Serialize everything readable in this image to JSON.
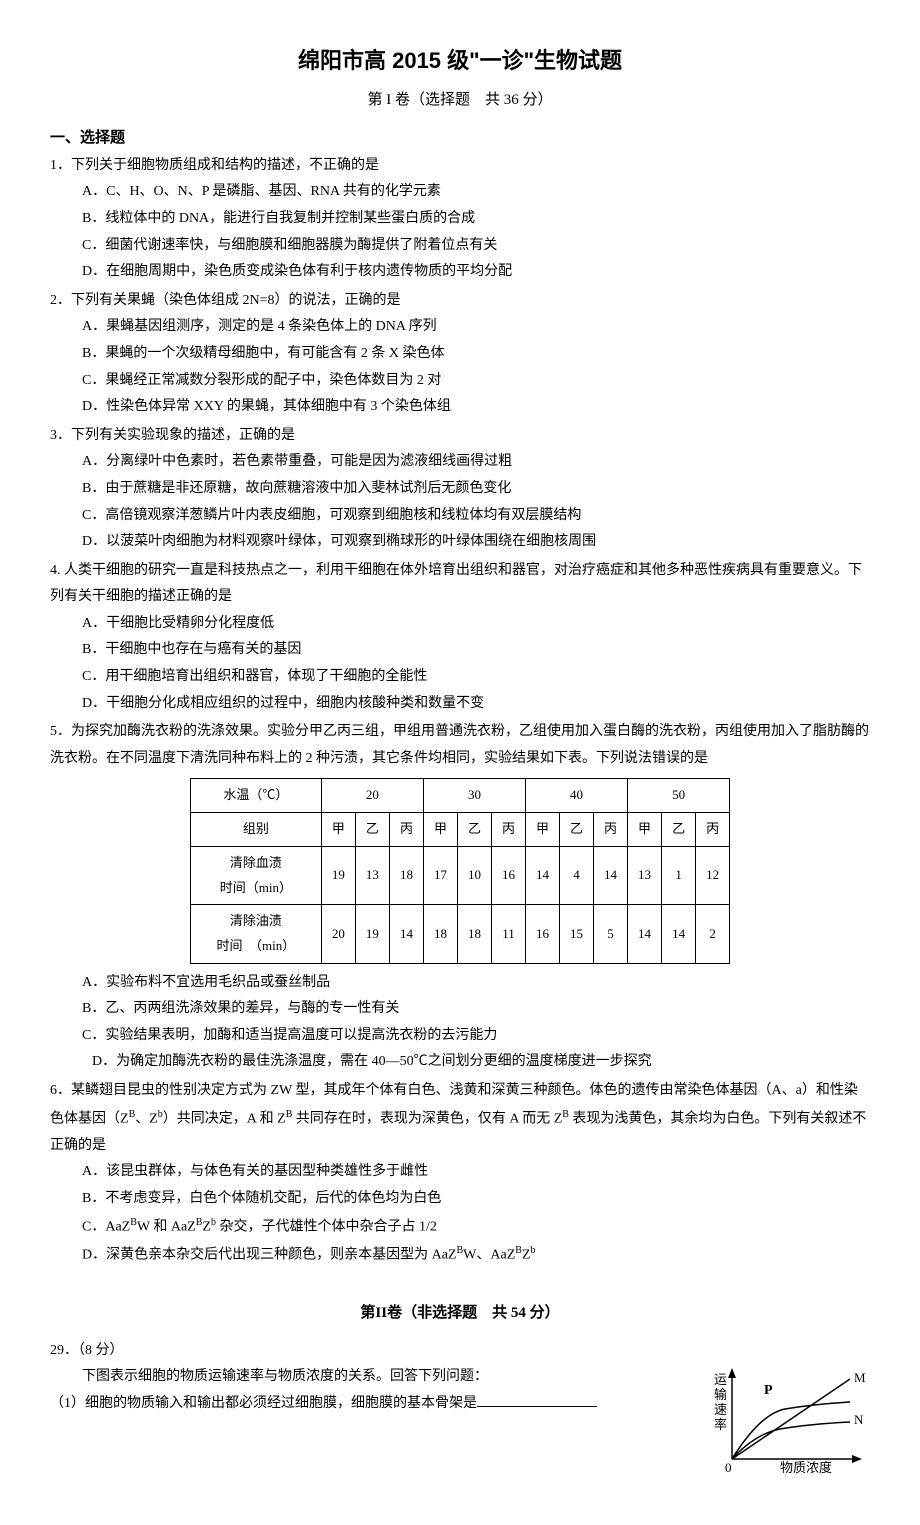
{
  "title": "绵阳市高 2015 级\"一诊\"生物试题",
  "subtitle": "第 I 卷（选择题　共 36 分）",
  "section1": "一、选择题",
  "q1": {
    "stem": "1．下列关于细胞物质组成和结构的描述，不正确的是",
    "A": "A．C、H、O、N、P 是磷脂、基因、RNA 共有的化学元素",
    "B": "B．线粒体中的 DNA，能进行自我复制并控制某些蛋白质的合成",
    "C": "C．细菌代谢速率快，与细胞膜和细胞器膜为酶提供了附着位点有关",
    "D": "D．在细胞周期中，染色质变成染色体有利于核内遗传物质的平均分配"
  },
  "q2": {
    "stem": "2．下列有关果蝇（染色体组成 2N=8）的说法，正确的是",
    "A": "A．果蝇基因组测序，测定的是 4 条染色体上的 DNA 序列",
    "B": "B．果蝇的一个次级精母细胞中，有可能含有 2 条 X 染色体",
    "C": "C．果蝇经正常减数分裂形成的配子中，染色体数目为 2 对",
    "D": "D．性染色体异常 XXY 的果蝇，其体细胞中有 3 个染色体组"
  },
  "q3": {
    "stem": "3．下列有关实验现象的描述，正确的是",
    "A": "A．分离绿叶中色素时，若色素带重叠，可能是因为滤液细线画得过粗",
    "B": "B．由于蔗糖是非还原糖，故向蔗糖溶液中加入斐林试剂后无颜色变化",
    "C": "C．高倍镜观察洋葱鳞片叶内表皮细胞，可观察到细胞核和线粒体均有双层膜结构",
    "D": "D．以菠菜叶肉细胞为材料观察叶绿体，可观察到椭球形的叶绿体围绕在细胞核周围"
  },
  "q4": {
    "stem": "4. 人类干细胞的研究一直是科技热点之一，利用干细胞在体外培育出组织和器官，对治疗癌症和其他多种恶性疾病具有重要意义。下列有关干细胞的描述正确的是",
    "A": "A．干细胞比受精卵分化程度低",
    "B": "B．干细胞中也存在与癌有关的基因",
    "C": "C．用干细胞培育出组织和器官，体现了干细胞的全能性",
    "D": "D．干细胞分化成相应组织的过程中，细胞内核酸种类和数量不变"
  },
  "q5": {
    "stem": "5．为探究加酶洗衣粉的洗涤效果。实验分甲乙丙三组，甲组用普通洗衣粉，乙组使用加入蛋白酶的洗衣粉，丙组使用加入了脂肪酶的洗衣粉。在不同温度下清洗同种布料上的 2 种污渍，其它条件均相同，实验结果如下表。下列说法错误的是",
    "A": "A．实验布料不宜选用毛织品或蚕丝制品",
    "B": "B．乙、丙两组洗涤效果的差异，与酶的专一性有关",
    "C": "C．实验结果表明，加酶和适当提高温度可以提高洗衣粉的去污能力",
    "D": "D．为确定加酶洗衣粉的最佳洗涤温度，需在 40—50℃之间划分更细的温度梯度进一步探究"
  },
  "table": {
    "header_temp": "水温（℃）",
    "header_group": "组别",
    "temps": [
      "20",
      "30",
      "40",
      "50"
    ],
    "groups": [
      "甲",
      "乙",
      "丙"
    ],
    "row1_label": "清除血渍",
    "row1_sub": "时间（min）",
    "row1": [
      "19",
      "13",
      "18",
      "17",
      "10",
      "16",
      "14",
      "4",
      "14",
      "13",
      "1",
      "12"
    ],
    "row2_label": "清除油渍",
    "row2_sub": "时间　（min）",
    "row2": [
      "20",
      "19",
      "14",
      "18",
      "18",
      "11",
      "16",
      "15",
      "5",
      "14",
      "14",
      "2"
    ]
  },
  "q6": {
    "stem_p1": "6．某鳞翅目昆虫的性别决定方式为 ZW 型，其成年个体有白色、浅黄和深黄三种颜色。体色的遗传由常染色体基因（A、a）和性染色体基因（Z",
    "stem_p2": "、Z",
    "stem_p3": "）共同决定，A 和 Z",
    "stem_p4": " 共同存在时，表现为深黄色，仅有 A 而无 Z",
    "stem_p5": " 表现为浅黄色，其余均为白色。下列有关叙述不正确的是",
    "A": "A．该昆虫群体，与体色有关的基因型种类雄性多于雌性",
    "B": "B．不考虑变异，白色个体随机交配，后代的体色均为白色",
    "C_p1": "C．AaZ",
    "C_p2": "W 和 AaZ",
    "C_p3": "Z",
    "C_p4": " 杂交，子代雄性个体中杂合子占 1/2",
    "D_p1": "D．深黄色亲本杂交后代出现三种颜色，则亲本基因型为 AaZ",
    "D_p2": "W、AaZ",
    "D_p3": "Z"
  },
  "section2_title": "第II卷（非选择题　共 54 分）",
  "q29": {
    "num": "29．（8 分）",
    "intro": "下图表示细胞的物质运输速率与物质浓度的关系。回答下列问题：",
    "p1": "（1）细胞的物质输入和输出都必须经过细胞膜，细胞膜的基本骨架是"
  },
  "chart": {
    "ylabel": "运输速率",
    "xlabel": "物质浓度",
    "lineP": "P",
    "lineM": "M",
    "lineN": "N",
    "origin": "0"
  }
}
